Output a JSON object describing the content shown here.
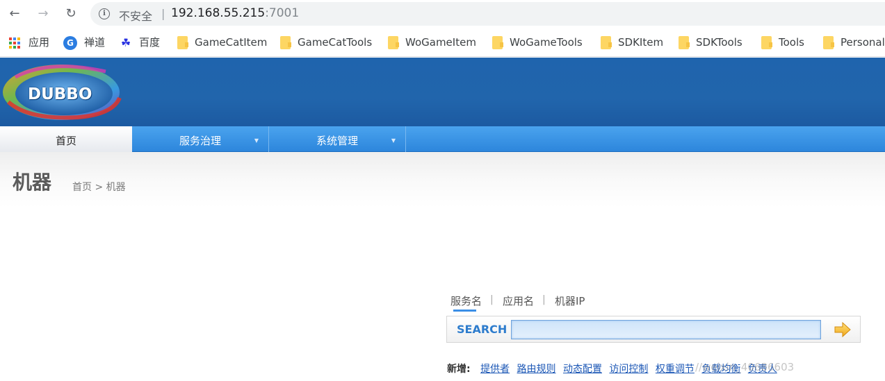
{
  "browser": {
    "security_label": "不安全",
    "separator": "|",
    "url_host": "192.168.55.215",
    "url_port": ":7001"
  },
  "bookmarks": [
    {
      "label": "应用",
      "icon": "apps-grid-icon"
    },
    {
      "label": "禅道",
      "icon": "chandao-icon"
    },
    {
      "label": "百度",
      "icon": "baidu-icon"
    },
    {
      "label": "GameCatItem",
      "icon": "folder-icon"
    },
    {
      "label": "GameCatTools",
      "icon": "folder-icon"
    },
    {
      "label": "WoGameItem",
      "icon": "folder-icon"
    },
    {
      "label": "WoGameTools",
      "icon": "folder-icon"
    },
    {
      "label": "SDKItem",
      "icon": "folder-icon"
    },
    {
      "label": "SDKTools",
      "icon": "folder-icon"
    },
    {
      "label": "Tools",
      "icon": "folder-icon"
    },
    {
      "label": "Personal",
      "icon": "folder-icon"
    }
  ],
  "logo": {
    "text": "DUBBO"
  },
  "menu": [
    {
      "label": "首页",
      "active": true
    },
    {
      "label": "服务治理",
      "active": false
    },
    {
      "label": "系统管理",
      "active": false
    }
  ],
  "page": {
    "title": "机器",
    "breadcrumb": "首页 > 机器"
  },
  "search": {
    "tabs": [
      "服务名",
      "应用名",
      "机器IP"
    ],
    "tab_separator": "|",
    "label": "SEARCH",
    "value": ""
  },
  "add": {
    "label": "新增:",
    "links": [
      "提供者",
      "路由规则",
      "动态配置",
      "访问控制",
      "权重调节",
      "负载均衡",
      "负责人"
    ]
  },
  "watermark": "//weixin_40686603",
  "colors": {
    "header_blue": "#2165ac",
    "menu_blue": "#2d86dc",
    "link_blue": "#1a56b5"
  }
}
